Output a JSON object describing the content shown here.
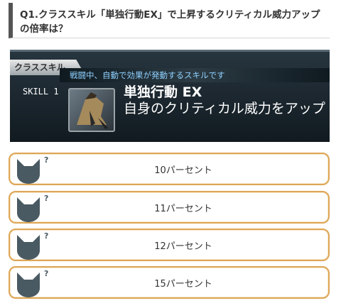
{
  "question": {
    "text": "Q1.クラススキル「単独行動EX」で上昇するクリティカル威力アップの倍率は？"
  },
  "skill_card": {
    "tab_label": "クラススキル",
    "subtitle": "戦闘中、自動で効果が発動するスキルです",
    "level": "SKILL 1",
    "name": "単独行動 EX",
    "description": "自身のクリティカル威力をアップ",
    "icon": "cloaked-figure-icon"
  },
  "options": [
    {
      "label": "10パーセント",
      "icon": "cat-icon",
      "mark": "?"
    },
    {
      "label": "11パーセント",
      "icon": "cat-icon",
      "mark": "?"
    },
    {
      "label": "12パーセント",
      "icon": "cat-icon",
      "mark": "?"
    },
    {
      "label": "15パーセント",
      "icon": "cat-icon",
      "mark": "?"
    }
  ],
  "colors": {
    "option_border": "#dda656",
    "cat_icon": "#4a5a62",
    "question_bar": "#555555",
    "skill_subtitle": "#8fd0ff"
  }
}
